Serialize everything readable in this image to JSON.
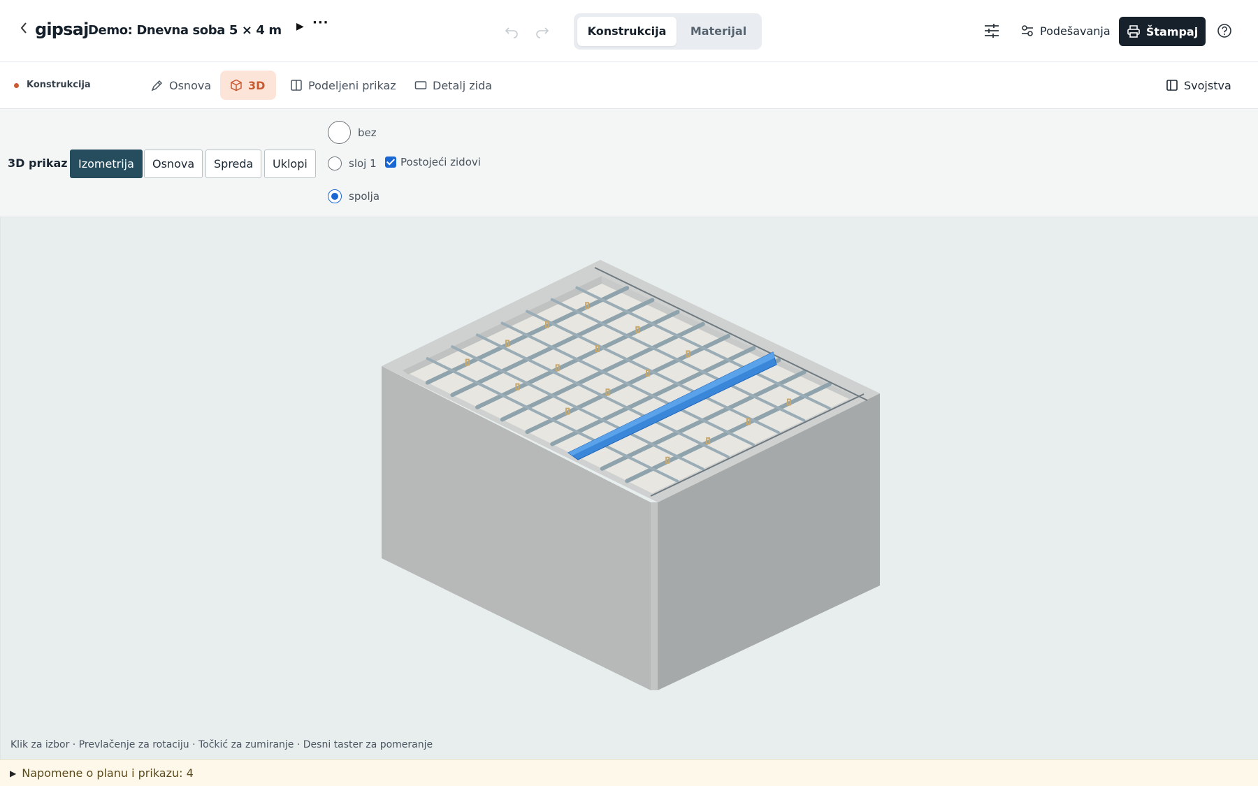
{
  "header": {
    "brand": "gipsaj",
    "doc_title": "Demo: Dnevna soba 5 × 4 m",
    "mode_tabs": [
      {
        "label": "Konstrukcija",
        "active": true
      },
      {
        "label": "Materijal",
        "active": false
      }
    ],
    "settings_label": "Podešavanja",
    "print_label": "Štampaj",
    "icons": {
      "back": "chevron-left-icon",
      "play": "play-icon",
      "more": "more-dots-icon",
      "undo": "undo-icon",
      "redo": "redo-icon",
      "sliders": "sliders-icon",
      "settings": "settings-toggle-icon",
      "print": "printer-icon",
      "help": "help-circle-icon"
    }
  },
  "subbar": {
    "context_label": "Konstrukcija",
    "context_dot_color": "#c95b33",
    "view_tabs": [
      {
        "label": "Osnova",
        "icon": "pen-icon",
        "active": false
      },
      {
        "label": "3D",
        "icon": "cube-icon",
        "active": true
      },
      {
        "label": "Podeljeni prikaz",
        "icon": "split-view-icon",
        "active": false
      },
      {
        "label": "Detalj zida",
        "icon": "wall-rect-icon",
        "active": false
      }
    ],
    "properties_label": "Svojstva"
  },
  "controls": {
    "title": "3D prikaz",
    "view_buttons": [
      {
        "label": "Izometrija",
        "active": true
      },
      {
        "label": "Osnova",
        "active": false
      },
      {
        "label": "Spreda",
        "active": false
      },
      {
        "label": "Uklopi",
        "active": false
      }
    ],
    "layer_options": [
      {
        "label": "bez",
        "checked": false
      },
      {
        "label": "sloj 1",
        "checked": false
      },
      {
        "label": "spolja",
        "checked": true
      }
    ],
    "existing_walls_label": "Postojeći zidovi",
    "existing_walls_checked": true
  },
  "viewport": {
    "hint": "Klik za izbor · Prevlačenje za rotaciju · Točkić za zumiranje · Desni taster za pomeranje"
  },
  "notes": {
    "label": "Napomene o planu i prikazu: 4"
  },
  "colors": {
    "accent": "#c95b33",
    "primary_dark": "#17212b",
    "active_view": "#254d5e",
    "selected_beam": "#3a86d8",
    "profile": "#8fa3ad",
    "hanger": "#c9a86a"
  }
}
